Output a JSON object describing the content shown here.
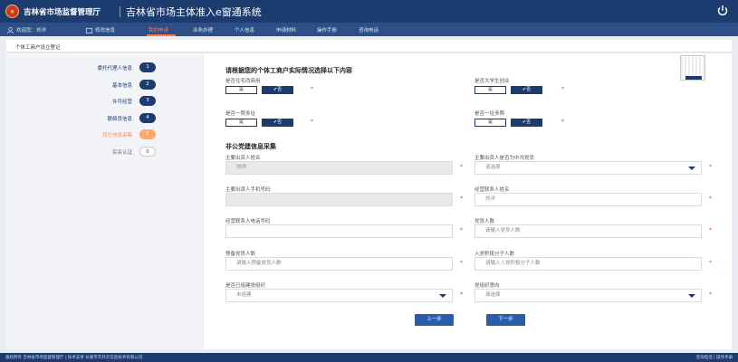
{
  "header": {
    "org_name": "吉林省市场监督管理厅",
    "system_name": "吉林省市场主体准入e窗通系统"
  },
  "nav": {
    "welcome": "欢迎您：刘洋",
    "items": [
      "修改信息",
      "我的申请",
      "业务办理",
      "个人信息",
      "申请材料",
      "操作手册",
      "咨询电话"
    ],
    "active": "我的申请"
  },
  "breadcrumb": "个体工商户设立登记",
  "steps": [
    {
      "label": "委托代理人信息",
      "num": "1"
    },
    {
      "label": "基本信息",
      "num": "2"
    },
    {
      "label": "许可经营",
      "num": "3"
    },
    {
      "label": "联络员信息",
      "num": "4"
    },
    {
      "label": "其它信息采集",
      "num": "5"
    },
    {
      "label": "实名认证",
      "num": "6"
    }
  ],
  "situation": {
    "title": "请根据您的个体工商户实际情况选择以下内容",
    "questions": [
      "是否住宅改商用",
      "是否大学生创业",
      "是否一照多址",
      "是否一址多照"
    ],
    "yes_label": "是",
    "no_label": "✔否"
  },
  "party": {
    "title": "非公党建信息采集",
    "investor_name_label": "主要出资人姓名",
    "investor_name_value": "刘洋",
    "investor_party_label": "主要出资人是否为中共党员",
    "investor_party_placeholder": "请选择",
    "investor_phone_label": "主要出资人手机号码",
    "investor_phone_value": "",
    "liaison_name_label": "经营联系人姓名",
    "liaison_name_value": "刘洋",
    "liaison_phone_label": "经营联系人电话号码",
    "liaison_phone_value": "",
    "party_members_label": "党员人数",
    "party_members_placeholder": "请输入党员人数",
    "probation_label": "预备党员人数",
    "probation_placeholder": "请输入预备党员人数",
    "activists_label": "入党积极分子人数",
    "activists_placeholder": "请输入入党积极分子人数",
    "org_built_label": "是否已组建党组织",
    "org_built_value": "未组建",
    "willing_label": "党组织意向",
    "willing_placeholder": "请选择"
  },
  "buttons": {
    "prev": "上一步",
    "next": "下一步"
  },
  "footer": {
    "left": "版权所有 吉林省市场监督管理厅 | 技术支持 长春市丰开云信息技术有限公司",
    "right": "咨询电话 | 操作手册"
  },
  "colors": {
    "brand_navy": "#1c3b6e",
    "accent_orange": "#ff7a45",
    "button_blue": "#2a5ca8"
  }
}
